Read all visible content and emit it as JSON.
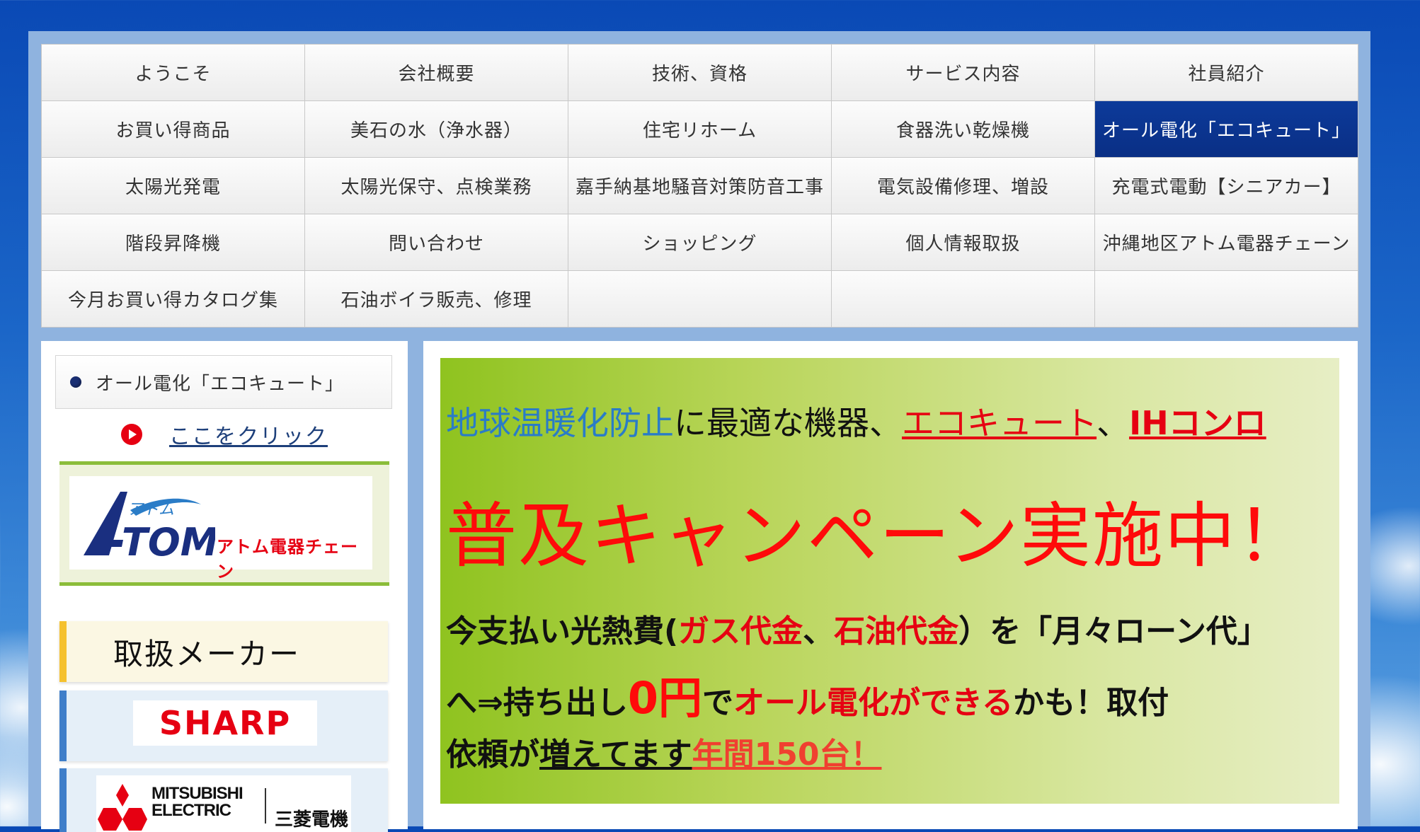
{
  "nav": {
    "items": [
      {
        "label": "ようこそ",
        "active": false
      },
      {
        "label": "会社概要",
        "active": false
      },
      {
        "label": "技術、資格",
        "active": false
      },
      {
        "label": "サービス内容",
        "active": false
      },
      {
        "label": "社員紹介",
        "active": false
      },
      {
        "label": "お買い得商品",
        "active": false
      },
      {
        "label": "美石の水（浄水器）",
        "active": false
      },
      {
        "label": "住宅リホーム",
        "active": false
      },
      {
        "label": "食器洗い乾燥機",
        "active": false
      },
      {
        "label": "オール電化「エコキュート」",
        "active": true
      },
      {
        "label": "太陽光発電",
        "active": false
      },
      {
        "label": "太陽光保守、点検業務",
        "active": false
      },
      {
        "label": "嘉手納基地騒音対策防音工事",
        "active": false
      },
      {
        "label": "電気設備修理、増設",
        "active": false
      },
      {
        "label": "充電式電動【シニアカー】",
        "active": false
      },
      {
        "label": "階段昇降機",
        "active": false
      },
      {
        "label": "問い合わせ",
        "active": false
      },
      {
        "label": "ショッピング",
        "active": false
      },
      {
        "label": "個人情報取扱",
        "active": false
      },
      {
        "label": "沖縄地区アトム電器チェーン",
        "active": false
      },
      {
        "label": "今月お買い得カタログ集",
        "active": false
      },
      {
        "label": "石油ボイラ販売、修理",
        "active": false
      }
    ],
    "active_color": "#0a2f85"
  },
  "sidebar": {
    "current_page": "オール電化「エコキュート」",
    "click_link": "ここをクリック",
    "atom_logo": {
      "mark_text": "アトム",
      "wordmark": "TOM",
      "chain_text": "アトム電器チェーン"
    },
    "maker_heading": "取扱メーカー",
    "makers": [
      {
        "name": "SHARP"
      },
      {
        "name": "MITSUBISHI ELECTRIC",
        "name_line1": "MITSUBISHI",
        "name_line2": "ELECTRIC",
        "name_jp": "三菱電機"
      }
    ]
  },
  "banner": {
    "line1": {
      "part1": "地球温暖化防止",
      "part2": "に最適な機器、",
      "part3": "エコキュート",
      "part4": "、",
      "part5": "IHコンロ"
    },
    "headline": "普及キャンペーン実施中！",
    "line3": {
      "part1": "今支払い光熱費(",
      "part2": "ガス代金",
      "part3": "、",
      "part4": "石油代金",
      "part5": "）を「月々ローン代」"
    },
    "line4": {
      "part1": "へ⇒持ち出し",
      "part2": "0円",
      "part3": "で",
      "part4": "オール電化ができる",
      "part5": "かも！取付"
    },
    "line5": {
      "part1": "依頼が",
      "part2": "増えてます",
      "part3": "年間150台！"
    },
    "colors": {
      "red": "#e60012",
      "blue": "#2a7cc7",
      "green_start": "#8fc31f"
    }
  }
}
